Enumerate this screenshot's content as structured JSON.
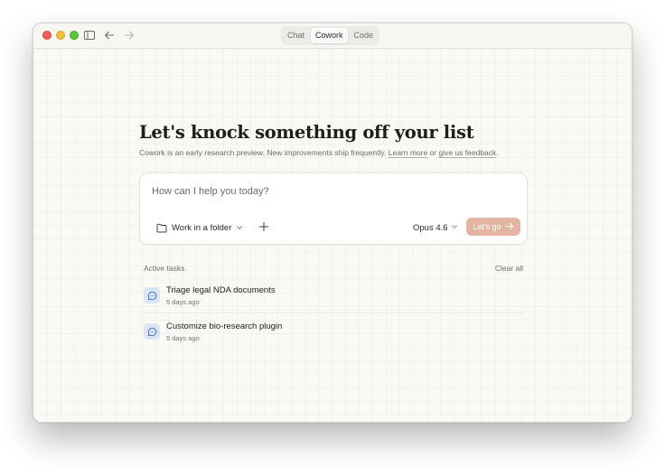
{
  "titlebar": {
    "modes": [
      {
        "label": "Chat",
        "active": false
      },
      {
        "label": "Cowork",
        "active": true
      },
      {
        "label": "Code",
        "active": false
      }
    ]
  },
  "main": {
    "headline": "Let's knock something off your list",
    "subline": {
      "prefix": "Cowork is an early research preview. New improvements ship frequently. ",
      "learn_more": "Learn more",
      "middle": " or ",
      "feedback": "give us feedback",
      "suffix": "."
    },
    "composer": {
      "placeholder": "How can I help you today?",
      "folder_label": "Work in a folder",
      "model": "Opus 4.6",
      "go_label": "Let's go"
    },
    "tasks": {
      "title": "Active tasks",
      "clear_label": "Clear all",
      "items": [
        {
          "title": "Triage legal NDA documents",
          "time": "5 days ago"
        },
        {
          "title": "Customize bio-research plugin",
          "time": "5 days ago"
        }
      ]
    }
  },
  "colors": {
    "background": "#faf9f5",
    "accent": "#e3b5a1",
    "task_icon_bg": "#dae6f5",
    "task_icon_fg": "#3b6fb6",
    "traffic_red": "#ee5f57",
    "traffic_yellow": "#f6bd3a",
    "traffic_green": "#5fc33f"
  },
  "icons": [
    "sidebar-toggle-icon",
    "back-arrow-icon",
    "forward-arrow-icon",
    "folder-icon",
    "chevron-down-icon",
    "plus-icon",
    "arrow-right-icon",
    "chat-bubble-icon"
  ]
}
